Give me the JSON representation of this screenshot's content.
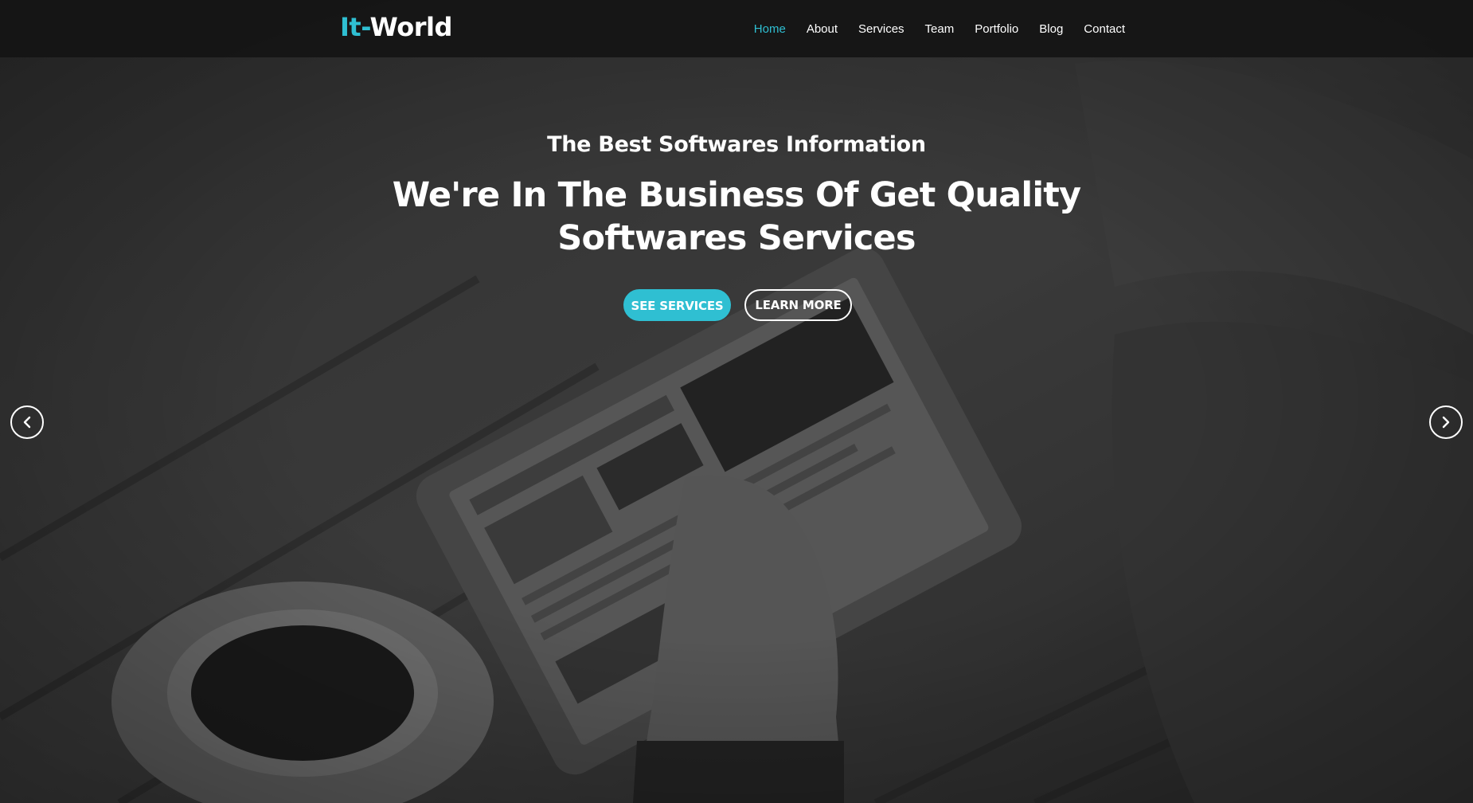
{
  "brand": {
    "logo_accent": "It-",
    "logo_main": "World"
  },
  "nav": {
    "items": [
      {
        "label": "Home",
        "active": true
      },
      {
        "label": "About",
        "active": false
      },
      {
        "label": "Services",
        "active": false
      },
      {
        "label": "Team",
        "active": false
      },
      {
        "label": "Portfolio",
        "active": false
      },
      {
        "label": "Blog",
        "active": false
      },
      {
        "label": "Contact",
        "active": false
      }
    ]
  },
  "hero": {
    "eyebrow": "The Best Softwares Information",
    "headline": "We're In The Business Of Get Quality Softwares Services",
    "primary_button": "SEE SERVICES",
    "secondary_button": "LEARN MORE",
    "prev_icon": "chevron-left-icon",
    "next_icon": "chevron-right-icon"
  },
  "colors": {
    "accent": "#2fbfd2",
    "navbar_bg": "#141414",
    "text": "#ffffff"
  }
}
